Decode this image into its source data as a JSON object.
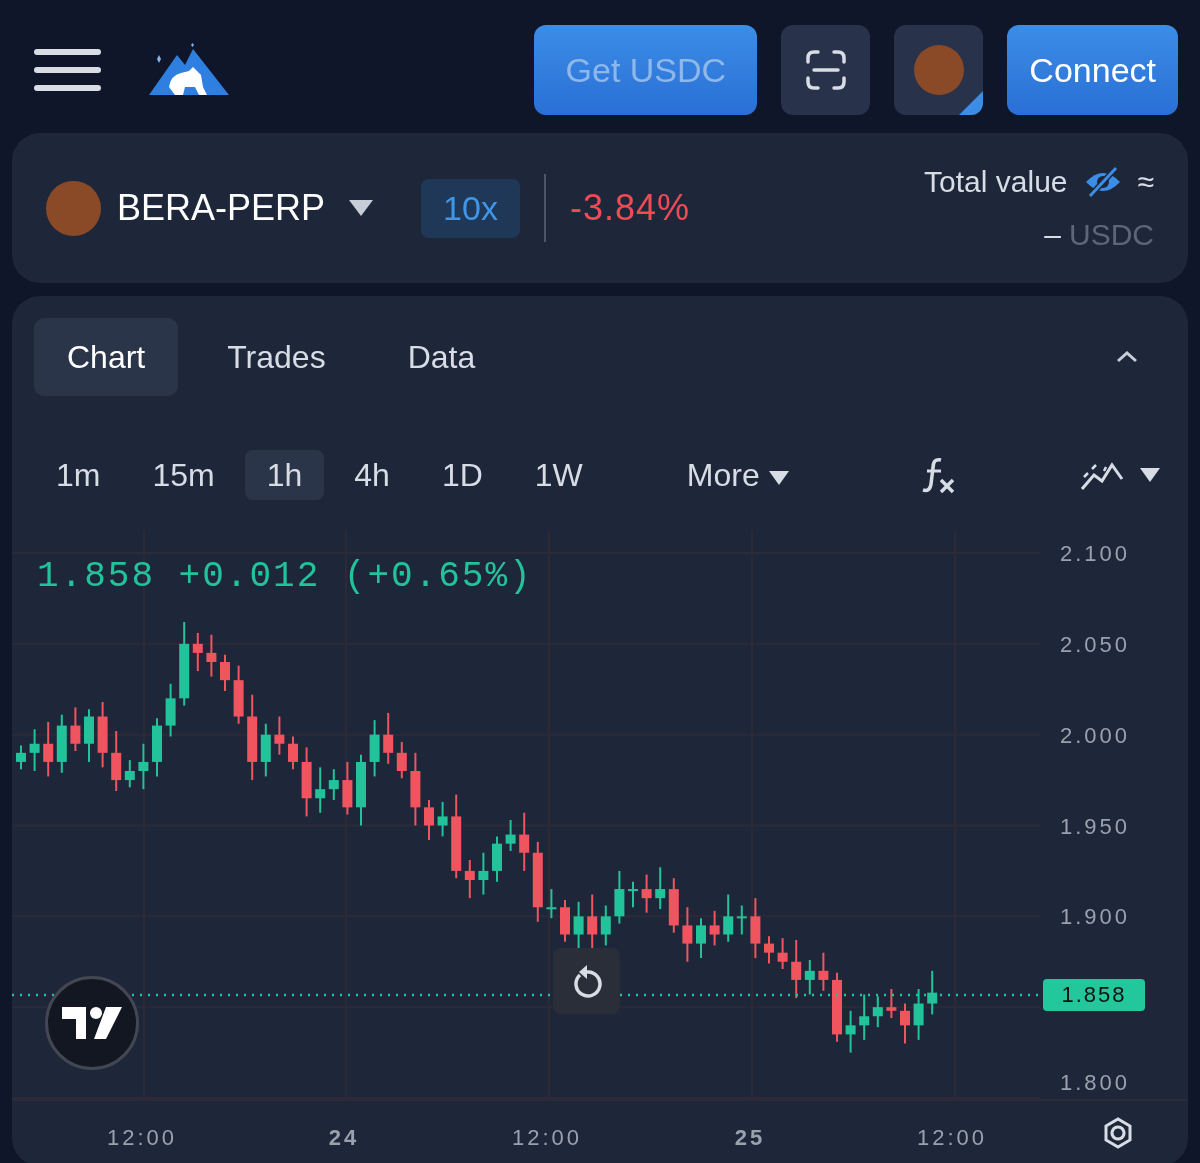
{
  "header": {
    "buttons": [
      {
        "kind": "text",
        "label": "Get USDC",
        "disabled": true
      },
      {
        "kind": "scan"
      },
      {
        "kind": "avatar"
      },
      {
        "kind": "text",
        "label": "Connect",
        "disabled": false
      }
    ]
  },
  "market": {
    "symbol": "BERA-PERP",
    "leverage": "10x",
    "change": "-3.84%",
    "total_value_label": "Total value",
    "approx": "≈",
    "value": "–",
    "currency": "USDC"
  },
  "panel_tabs": [
    {
      "label": "Chart",
      "selected": true
    },
    {
      "label": "Trades",
      "selected": false
    },
    {
      "label": "Data",
      "selected": false
    }
  ],
  "intervals": [
    {
      "label": "1m",
      "selected": false
    },
    {
      "label": "15m",
      "selected": false
    },
    {
      "label": "1h",
      "selected": true
    },
    {
      "label": "4h",
      "selected": false
    },
    {
      "label": "1D",
      "selected": false
    },
    {
      "label": "1W",
      "selected": false
    }
  ],
  "more": "More",
  "chart": {
    "legend_price": "1.858",
    "legend_change": "+0.012 (+0.65%)",
    "y_ticks": [
      "2.100",
      "2.050",
      "2.000",
      "1.950",
      "1.900",
      "1.800"
    ],
    "last_price": "1.858",
    "x_ticks": [
      {
        "label": "12:00",
        "bold": false
      },
      {
        "label": "24",
        "bold": true
      },
      {
        "label": "12:00",
        "bold": false
      },
      {
        "label": "25",
        "bold": true
      },
      {
        "label": "12:00",
        "bold": false
      }
    ]
  }
}
